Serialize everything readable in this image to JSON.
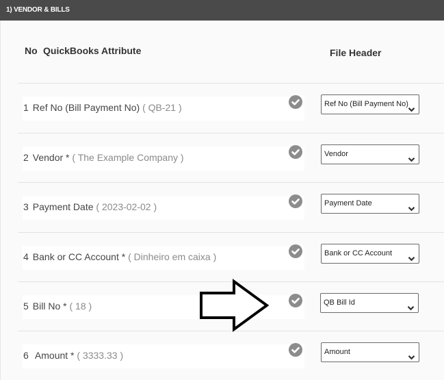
{
  "section": {
    "title": "1) VENDOR & BILLS"
  },
  "columns": {
    "no": "No",
    "attribute": "QuickBooks Attribute",
    "file_header": "File Header"
  },
  "rows": [
    {
      "no": "1",
      "attribute": "Ref No (Bill Payment No)",
      "value": "( QB-21 )",
      "status_icon": "check-circle-icon",
      "selected": "Ref No (Bill Payment No)"
    },
    {
      "no": "2",
      "attribute": "Vendor *",
      "value": "( The Example Company )",
      "status_icon": "check-circle-icon",
      "selected": "Vendor"
    },
    {
      "no": "3",
      "attribute": "Payment Date",
      "value": "( 2023-02-02 )",
      "status_icon": "check-circle-icon",
      "selected": "Payment Date"
    },
    {
      "no": "4",
      "attribute": "Bank or CC Account *",
      "value": "( Dinheiro em caixa )",
      "status_icon": "check-circle-icon",
      "selected": "Bank or CC Account"
    },
    {
      "no": "5",
      "attribute": "Bill No *",
      "value": "( 18 )",
      "status_icon": "check-circle-icon",
      "selected": "QB Bill Id"
    },
    {
      "no": "6",
      "attribute": " Amount *",
      "value": "( 3333.33 )",
      "status_icon": "check-circle-icon",
      "selected": "Amount"
    }
  ],
  "annotation": {
    "icon": "right-arrow-icon",
    "points_to_row": "5"
  },
  "colors": {
    "header_bg": "#4a4a4a",
    "check": "#8c8c8c"
  }
}
